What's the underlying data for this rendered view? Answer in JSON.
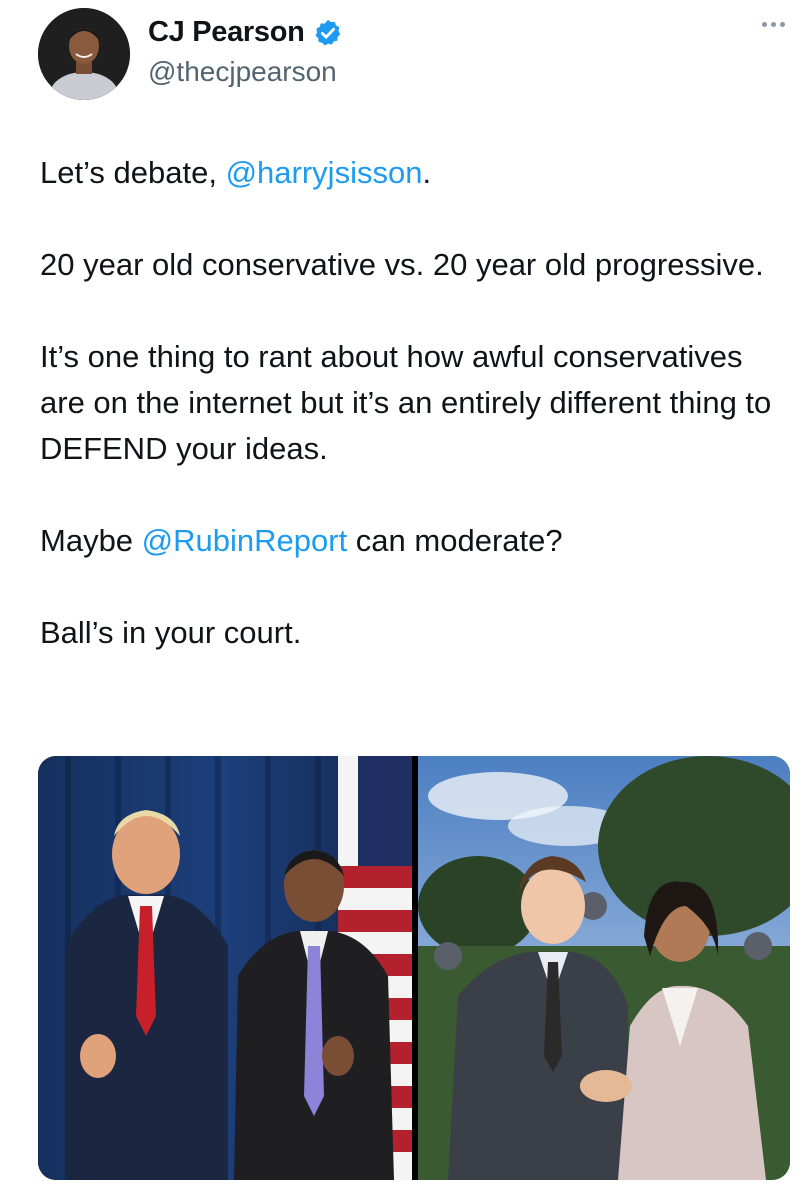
{
  "author": {
    "name": "CJ Pearson",
    "handle": "@thecjpearson",
    "verified": true
  },
  "tweet": {
    "line1_prefix": "Let’s debate, ",
    "line1_mention": "@harryjsisson",
    "line1_suffix": ".",
    "para2": "20 year old conservative vs. 20 year old progressive.",
    "para3": "It’s one thing to rant about how awful conservatives are on the internet but it’s an entirely different thing to DEFEND your ideas.",
    "para4_prefix": "Maybe ",
    "para4_mention": "@RubinReport",
    "para4_suffix": " can moderate?",
    "para5": "Ball’s in your court."
  },
  "icons": {
    "verified": "verified-badge-icon",
    "more": "more-options-icon"
  },
  "colors": {
    "link": "#1d9bf0",
    "secondary_text": "#536471",
    "verified": "#1d9bf0"
  }
}
